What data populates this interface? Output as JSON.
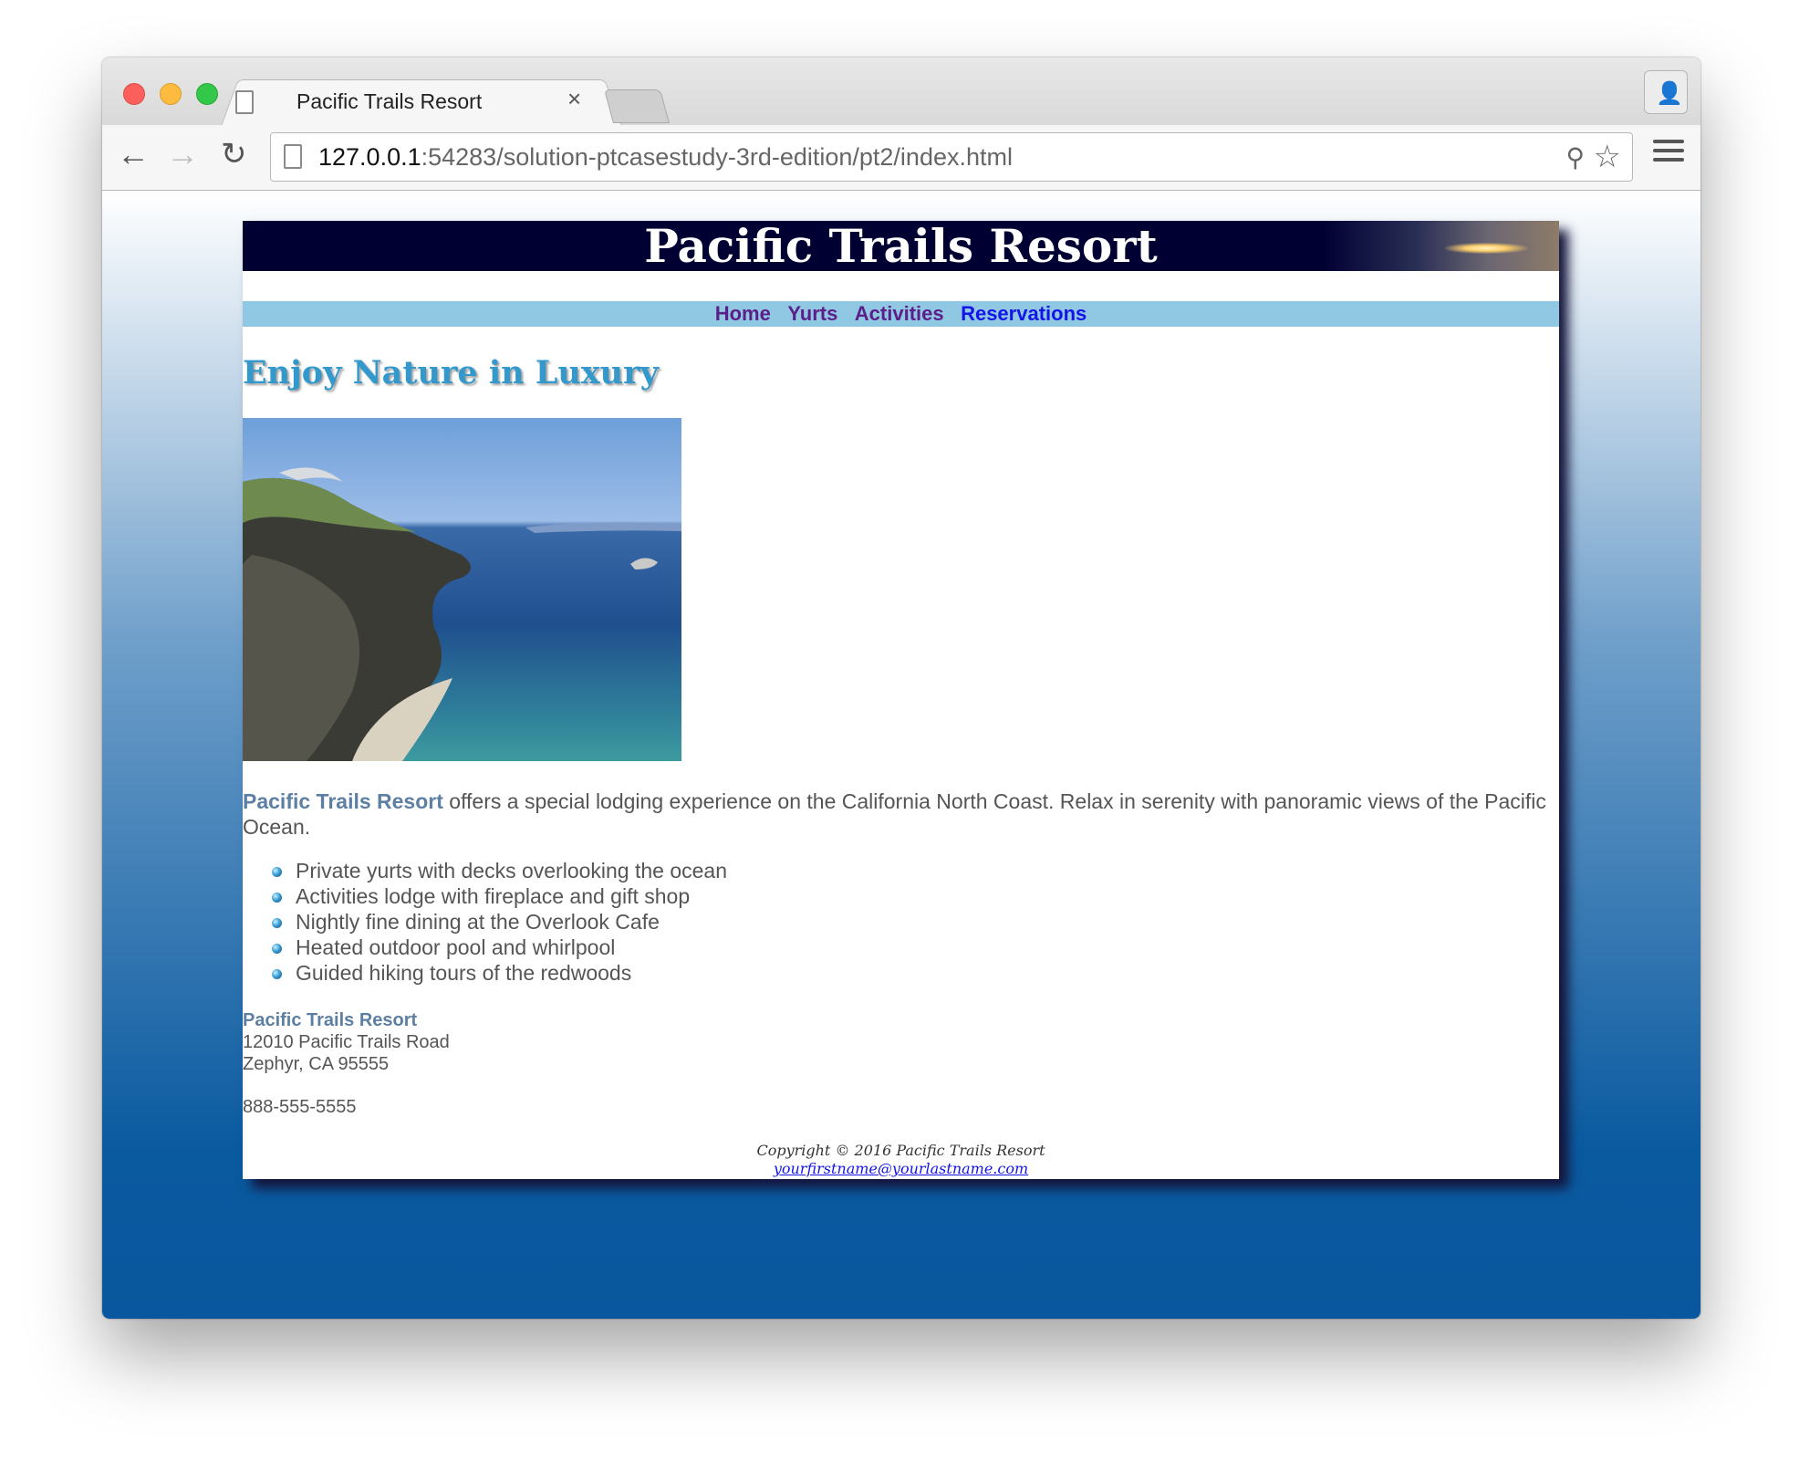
{
  "browser": {
    "tab_title": "Pacific Trails Resort",
    "tab_close": "×",
    "url_host": "127.0.0.1",
    "url_rest": ":54283/solution-ptcasestudy-3rd-edition/pt2/index.html",
    "icons": [
      "back-arrow-icon",
      "forward-arrow-icon",
      "reload-icon",
      "page-icon",
      "zoom-icon",
      "bookmark-star-icon",
      "menu-icon",
      "profile-icon"
    ]
  },
  "site": {
    "title": "Pacific Trails Resort",
    "nav": [
      {
        "label": "Home"
      },
      {
        "label": "Yurts"
      },
      {
        "label": "Activities"
      },
      {
        "label": "Reservations"
      }
    ],
    "heading": "Enjoy Nature in Luxury",
    "intro_name": "Pacific Trails Resort",
    "intro_text": " offers a special lodging experience on the California North Coast. Relax in serenity with panoramic views of the Pacific Ocean.",
    "features": [
      "Private yurts with decks overlooking the ocean",
      "Activities lodge with fireplace and gift shop",
      "Nightly fine dining at the Overlook Cafe",
      "Heated outdoor pool and whirlpool",
      "Guided hiking tours of the redwoods"
    ],
    "contact_name": "Pacific Trails Resort",
    "address_line1": "12010 Pacific Trails Road",
    "address_line2": "Zephyr, CA 95555",
    "phone": "888-555-5555",
    "copyright": "Copyright © 2016 Pacific Trails Resort",
    "email": "yourfirstname@yourlastname.com"
  },
  "colors": {
    "header_bg": "#000033",
    "nav_bg": "#90c7e3",
    "nav_link": "#5c1f89",
    "heading": "#3399cc",
    "resort_name": "#5c7fa3"
  }
}
